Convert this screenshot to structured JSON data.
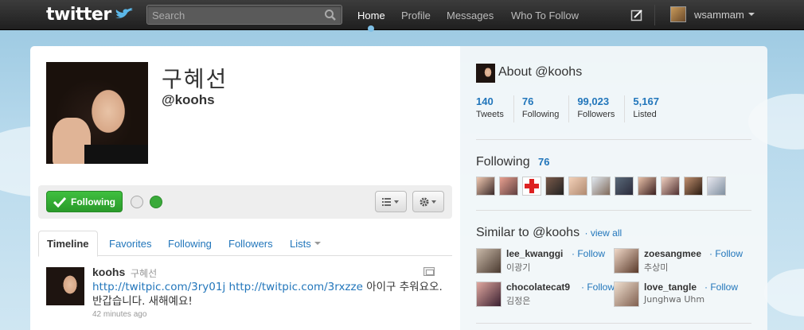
{
  "brand": {
    "name": "twitter"
  },
  "search": {
    "placeholder": "Search"
  },
  "nav": {
    "home": "Home",
    "profile": "Profile",
    "messages": "Messages",
    "who_to_follow": "Who To Follow"
  },
  "user": {
    "name": "wsammam"
  },
  "profile": {
    "full_name": "구혜선",
    "screen_name": "@koohs"
  },
  "actions": {
    "following_label": "Following"
  },
  "tabs": [
    "Timeline",
    "Favorites",
    "Following",
    "Followers",
    "Lists"
  ],
  "tweet": {
    "author": "koohs",
    "full_name": "구혜선",
    "link1": "http://twitpic.com/3ry01j",
    "link2": "http://twitpic.com/3rxzze",
    "text_line1": " 아이구 추워요오.",
    "text_line2": "반갑습니다. 새해예요!",
    "time": "42 minutes ago"
  },
  "about": {
    "title": "About @koohs",
    "stats": [
      {
        "value": "140",
        "label": "Tweets"
      },
      {
        "value": "76",
        "label": "Following"
      },
      {
        "value": "99,023",
        "label": "Followers"
      },
      {
        "value": "5,167",
        "label": "Listed"
      }
    ]
  },
  "following": {
    "title": "Following",
    "count": "76"
  },
  "similar": {
    "title": "Similar to @koohs",
    "view_all": "· view all",
    "follow_label": "· Follow",
    "users": [
      {
        "screen_name": "lee_kwanggi",
        "real_name": "이광기"
      },
      {
        "screen_name": "zoesangmee",
        "real_name": "추상미"
      },
      {
        "screen_name": "chocolatecat9",
        "real_name": "김정은"
      },
      {
        "screen_name": "love_tangle",
        "real_name": "Junghwa Uhm"
      }
    ]
  },
  "colors": {
    "link": "#2276bb",
    "follow_green": "#2a9a2a",
    "background": "#c0deed"
  }
}
